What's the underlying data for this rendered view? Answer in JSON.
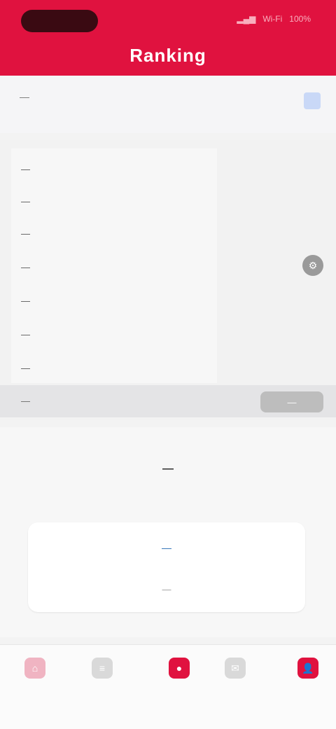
{
  "status_bar": {
    "signal": "▂▄▆",
    "wifi": "Wi‑Fi",
    "battery": "100%"
  },
  "header": {
    "title": "Ranking"
  },
  "top_strip": {
    "left_text": "—",
    "sub_text": "",
    "badge_icon": "info-icon"
  },
  "panel": {
    "rows": [
      {
        "label": "—",
        "value": ""
      },
      {
        "label": "—",
        "value": ""
      },
      {
        "label": "—",
        "value": ""
      },
      {
        "label": "—",
        "value": "",
        "action_icon": "gear-icon"
      },
      {
        "label": "—",
        "value": ""
      },
      {
        "label": "—",
        "value": ""
      },
      {
        "label": "—",
        "value": ""
      }
    ],
    "selected": {
      "label": "—",
      "action_label": "—"
    }
  },
  "info": {
    "title": "—",
    "card": {
      "link_text": "—",
      "meta_text": "—"
    }
  },
  "bottom_nav": {
    "items": [
      {
        "label": "",
        "icon": "home-icon"
      },
      {
        "label": "",
        "icon": "list-icon"
      },
      {
        "label": "",
        "icon": "center-icon"
      },
      {
        "label": "",
        "icon": "message-icon"
      },
      {
        "label": "",
        "icon": "profile-icon"
      }
    ]
  },
  "colors": {
    "accent": "#e0123f",
    "header_bg": "#e0123f",
    "link": "#2b6fb6"
  }
}
